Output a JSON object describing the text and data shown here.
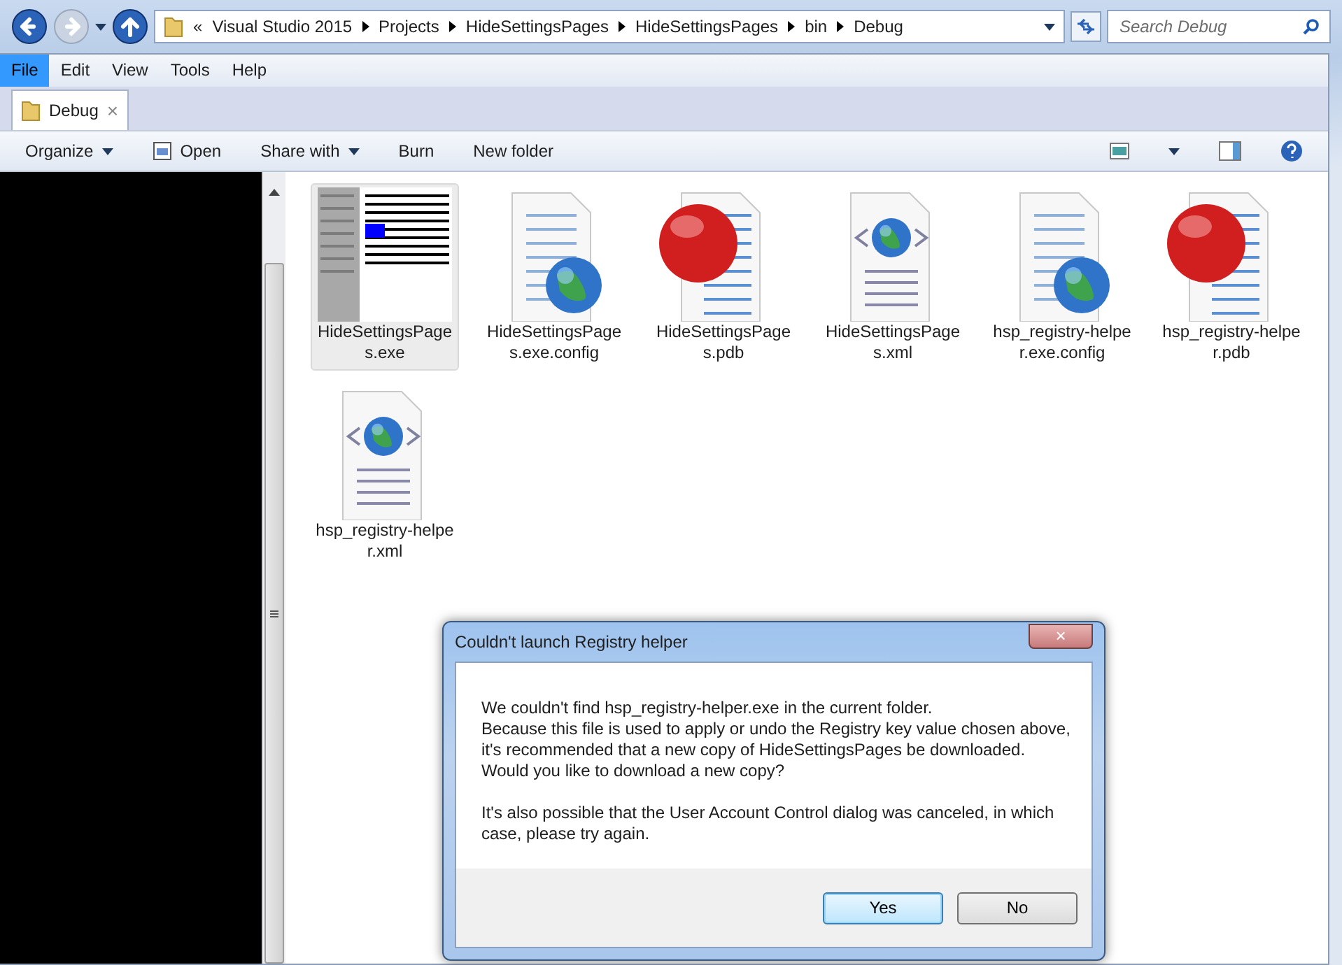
{
  "address_bar": {
    "overflow_mark": "«",
    "crumbs": [
      "Visual Studio 2015",
      "Projects",
      "HideSettingsPages",
      "HideSettingsPages",
      "bin",
      "Debug"
    ]
  },
  "search": {
    "placeholder": "Search Debug"
  },
  "menu": [
    {
      "label": "File",
      "selected": true
    },
    {
      "label": "Edit",
      "selected": false
    },
    {
      "label": "View",
      "selected": false
    },
    {
      "label": "Tools",
      "selected": false
    },
    {
      "label": "Help",
      "selected": false
    }
  ],
  "tabs": [
    {
      "label": "Debug",
      "close": "×",
      "selected": true
    }
  ],
  "commands": [
    {
      "label": "Organize",
      "kind": "dropdown"
    },
    {
      "label": "Open",
      "kind": "icon"
    },
    {
      "label": "Share with",
      "kind": "dropdown"
    },
    {
      "label": "Burn",
      "kind": "plain"
    },
    {
      "label": "New folder",
      "kind": "plain"
    }
  ],
  "files": [
    {
      "name": "HideSettingsPages.exe",
      "kind": "exe",
      "selected": true
    },
    {
      "name": "HideSettingsPages.exe.config",
      "kind": "config",
      "selected": false
    },
    {
      "name": "HideSettingsPages.pdb",
      "kind": "pdb",
      "selected": false
    },
    {
      "name": "HideSettingsPages.xml",
      "kind": "xml",
      "selected": false
    },
    {
      "name": "hsp_registry-helper.exe.config",
      "kind": "config",
      "selected": false
    },
    {
      "name": "hsp_registry-helper.pdb",
      "kind": "pdb",
      "selected": false
    },
    {
      "name": "hsp_registry-helper.xml",
      "kind": "xml",
      "selected": false
    }
  ],
  "dialog": {
    "title": "Couldn't launch Registry helper",
    "close": "×",
    "paragraphs": [
      "We couldn't find hsp_registry-helper.exe in the current folder.\nBecause this file is used to apply or undo the Registry key value chosen above,\nit's recommended that a new copy of HideSettingsPages be downloaded.\nWould you like to download a new copy?",
      "It's also possible that the User Account Control dialog was canceled, in which\ncase, please try again."
    ],
    "buttons": [
      {
        "label": "Yes",
        "selected": true
      },
      {
        "label": "No",
        "selected": false
      }
    ]
  }
}
